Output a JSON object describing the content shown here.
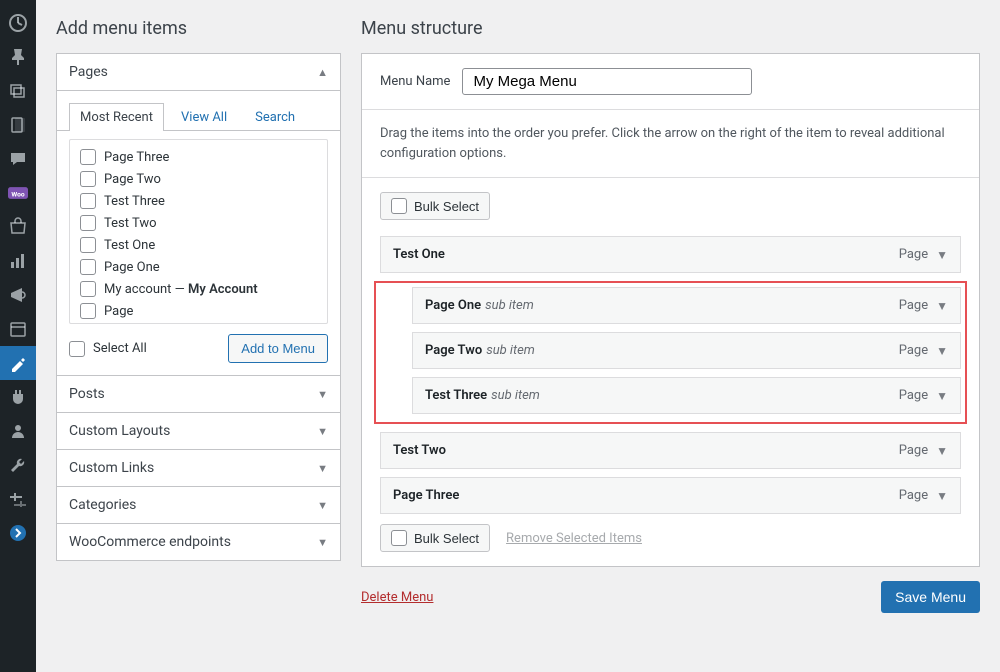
{
  "left": {
    "title": "Add menu items",
    "pages_panel": {
      "heading": "Pages",
      "tabs": [
        "Most Recent",
        "View All",
        "Search"
      ],
      "items": [
        "Page Three",
        "Page Two",
        "Test Three",
        "Test Two",
        "Test One",
        "Page One",
        "My account — <strong>My Account</strong>",
        "Page"
      ],
      "select_all": "Select All",
      "add_btn": "Add to Menu"
    },
    "accordions": [
      "Posts",
      "Custom Layouts",
      "Custom Links",
      "Categories",
      "WooCommerce endpoints"
    ]
  },
  "right": {
    "title": "Menu structure",
    "menu_name_label": "Menu Name",
    "menu_name_value": "My Mega Menu",
    "instructions": "Drag the items into the order you prefer. Click the arrow on the right of the item to reveal additional configuration options.",
    "bulk_select": "Bulk Select",
    "items": [
      {
        "label": "Test One",
        "type": "Page",
        "depth": 0,
        "group": "top"
      },
      {
        "label": "Page One",
        "type": "Page",
        "depth": 1,
        "sub": "sub item",
        "group": "hl"
      },
      {
        "label": "Page Two",
        "type": "Page",
        "depth": 1,
        "sub": "sub item",
        "group": "hl"
      },
      {
        "label": "Test Three",
        "type": "Page",
        "depth": 1,
        "sub": "sub item",
        "group": "hl"
      },
      {
        "label": "Test Two",
        "type": "Page",
        "depth": 0,
        "group": "after"
      },
      {
        "label": "Page Three",
        "type": "Page",
        "depth": 0,
        "group": "after"
      }
    ],
    "remove_selected": "Remove Selected Items",
    "delete_menu": "Delete Menu",
    "save_menu": "Save Menu"
  }
}
